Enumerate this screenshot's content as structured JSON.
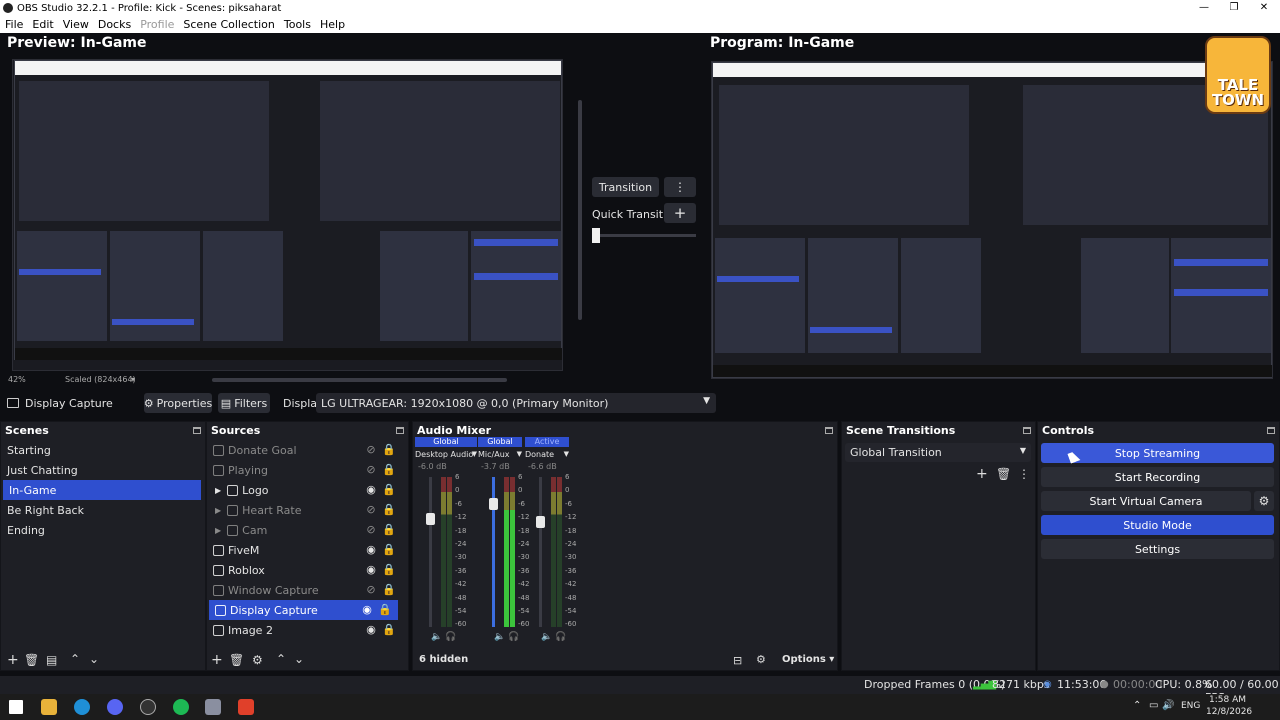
{
  "window": {
    "title": "OBS Studio 32.2.1 - Profile: Kick - Scenes: piksaharat"
  },
  "menu": [
    "File",
    "Edit",
    "View",
    "Docks",
    "Profile",
    "Scene Collection",
    "Tools",
    "Help"
  ],
  "preview": {
    "label": "Preview: In-Game",
    "zoom": "42%",
    "scaled": "Scaled (824x464)"
  },
  "program": {
    "label": "Program: In-Game"
  },
  "logo": {
    "line1": "TALE",
    "line2": "TOWN"
  },
  "transition_controls": {
    "transition_label": "Transition",
    "quick_label": "Quick Transitions"
  },
  "context_bar": {
    "source_name": "Display Capture",
    "properties_label": "Properties",
    "filters_label": "Filters",
    "display_label": "Display",
    "display_value": "LG ULTRAGEAR: 1920x1080 @ 0,0 (Primary Monitor)"
  },
  "scenes": {
    "title": "Scenes",
    "items": [
      "Starting",
      "Just Chatting",
      "In-Game",
      "Be Right Back",
      "Ending"
    ],
    "selected_index": 2
  },
  "sources": {
    "title": "Sources",
    "items": [
      {
        "name": "Donate Goal",
        "visible": false,
        "group": false
      },
      {
        "name": "Playing",
        "visible": false,
        "group": false
      },
      {
        "name": "Logo",
        "visible": true,
        "group": true
      },
      {
        "name": "Heart Rate",
        "visible": false,
        "group": true
      },
      {
        "name": "Cam",
        "visible": false,
        "group": true
      },
      {
        "name": "FiveM",
        "visible": true,
        "group": false
      },
      {
        "name": "Roblox",
        "visible": true,
        "group": false
      },
      {
        "name": "Window Capture",
        "visible": false,
        "group": false
      },
      {
        "name": "Display Capture",
        "visible": true,
        "group": false,
        "selected": true
      },
      {
        "name": "Image 2",
        "visible": true,
        "group": false
      }
    ]
  },
  "audio_mixer": {
    "title": "Audio Mixer",
    "hidden_label": "6 hidden",
    "options_label": "Options",
    "channels": [
      {
        "badge": "Global",
        "name": "Desktop Audio",
        "db": "-6.0 dB",
        "fader": 0.72,
        "level": 0.0
      },
      {
        "badge": "Global",
        "name": "Mic/Aux",
        "db": "-3.7 dB",
        "fader": 0.82,
        "level": 0.78
      },
      {
        "badge": "Active",
        "name": "Donate",
        "db": "-6.6 dB",
        "fader": 0.7,
        "level": 0.0
      }
    ],
    "scale": [
      "6",
      "0",
      "-6",
      "-12",
      "-18",
      "-24",
      "-30",
      "-36",
      "-42",
      "-48",
      "-54",
      "-60"
    ]
  },
  "scene_transitions": {
    "title": "Scene Transitions",
    "value": "Global Transition"
  },
  "controls": {
    "title": "Controls",
    "stop_streaming": "Stop Streaming",
    "start_recording": "Start Recording",
    "start_virtual_camera": "Start Virtual Camera",
    "studio_mode": "Studio Mode",
    "settings": "Settings"
  },
  "status": {
    "dropped": "Dropped Frames 0 (0.0%)",
    "bitrate": "8271 kbps",
    "stream_time": "11:53:06",
    "rec_time": "00:00:00",
    "cpu": "CPU: 0.8%",
    "fps": "60.00 / 60.00 FPS"
  },
  "taskbar": {
    "lang": "ENG",
    "time": "1:58 AM",
    "date": "12/8/2026"
  },
  "colors": {
    "accent": "#2f4fcf",
    "panel": "#1e1f25",
    "bg": "#0d0e12",
    "meter_green": "#3cc43c",
    "meter_yellow": "#c9c93a",
    "meter_red": "#c23a3a"
  }
}
